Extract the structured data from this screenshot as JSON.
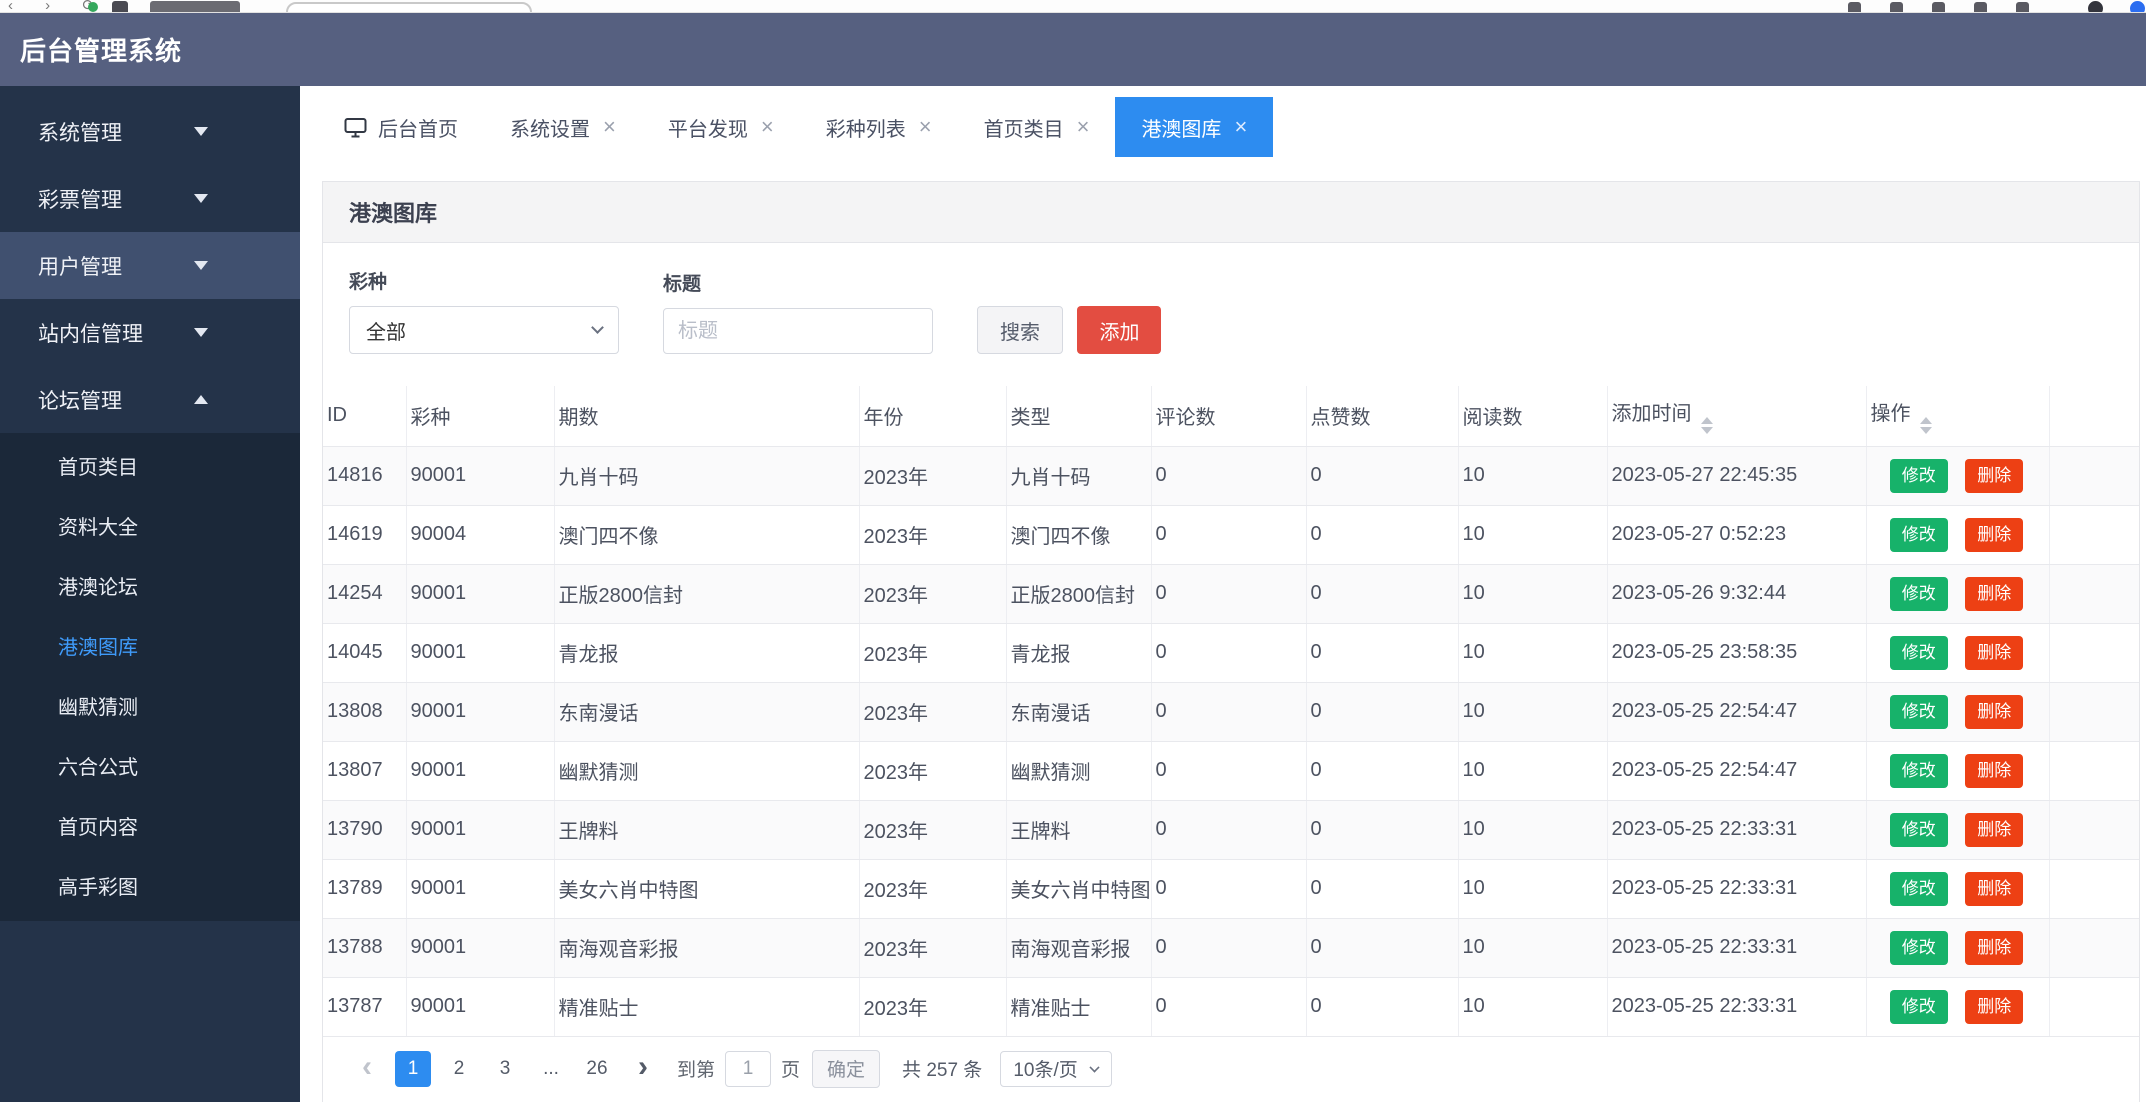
{
  "header": {
    "title": "后台管理系统"
  },
  "sidebar": {
    "items": [
      {
        "label": "系统管理",
        "active": false,
        "expanded": false
      },
      {
        "label": "彩票管理",
        "active": false,
        "expanded": false
      },
      {
        "label": "用户管理",
        "active": true,
        "expanded": false
      },
      {
        "label": "站内信管理",
        "active": false,
        "expanded": false
      },
      {
        "label": "论坛管理",
        "active": false,
        "expanded": true
      }
    ],
    "submenu": [
      {
        "label": "首页类目",
        "active": false
      },
      {
        "label": "资料大全",
        "active": false
      },
      {
        "label": "港澳论坛",
        "active": false
      },
      {
        "label": "港澳图库",
        "active": true
      },
      {
        "label": "幽默猜测",
        "active": false
      },
      {
        "label": "六合公式",
        "active": false
      },
      {
        "label": "首页内容",
        "active": false
      },
      {
        "label": "高手彩图",
        "active": false
      }
    ]
  },
  "tabs": [
    {
      "label": "后台首页",
      "icon": true,
      "closable": false,
      "active": false
    },
    {
      "label": "系统设置",
      "closable": true,
      "active": false
    },
    {
      "label": "平台发现",
      "closable": true,
      "active": false
    },
    {
      "label": "彩种列表",
      "closable": true,
      "active": false
    },
    {
      "label": "首页类目",
      "closable": true,
      "active": false
    },
    {
      "label": "港澳图库",
      "closable": true,
      "active": true
    }
  ],
  "icons": {
    "close": "×",
    "prev": "‹",
    "next": "›"
  },
  "panel": {
    "title": "港澳图库",
    "filters": {
      "lottery_label": "彩种",
      "lottery_value": "全部",
      "title_label": "标题",
      "title_placeholder": "标题",
      "search_label": "搜索",
      "add_label": "添加"
    }
  },
  "table": {
    "columns": [
      {
        "label": "ID"
      },
      {
        "label": "彩种"
      },
      {
        "label": "期数"
      },
      {
        "label": "年份"
      },
      {
        "label": "类型"
      },
      {
        "label": "评论数"
      },
      {
        "label": "点赞数"
      },
      {
        "label": "阅读数"
      },
      {
        "label": "添加时间",
        "sortable": true
      },
      {
        "label": "操作",
        "sortable": true
      }
    ],
    "edit_label": "修改",
    "delete_label": "删除",
    "rows": [
      {
        "id": "14816",
        "lottery": "90001",
        "issue": "九肖十码",
        "year": "2023年",
        "type": "九肖十码",
        "comments": "0",
        "likes": "0",
        "reads": "10",
        "time": "2023-05-27 22:45:35"
      },
      {
        "id": "14619",
        "lottery": "90004",
        "issue": "澳门四不像",
        "year": "2023年",
        "type": "澳门四不像",
        "comments": "0",
        "likes": "0",
        "reads": "10",
        "time": "2023-05-27 0:52:23"
      },
      {
        "id": "14254",
        "lottery": "90001",
        "issue": "正版2800信封",
        "year": "2023年",
        "type": "正版2800信封",
        "comments": "0",
        "likes": "0",
        "reads": "10",
        "time": "2023-05-26 9:32:44"
      },
      {
        "id": "14045",
        "lottery": "90001",
        "issue": "青龙报",
        "year": "2023年",
        "type": "青龙报",
        "comments": "0",
        "likes": "0",
        "reads": "10",
        "time": "2023-05-25 23:58:35"
      },
      {
        "id": "13808",
        "lottery": "90001",
        "issue": "东南漫话",
        "year": "2023年",
        "type": "东南漫话",
        "comments": "0",
        "likes": "0",
        "reads": "10",
        "time": "2023-05-25 22:54:47"
      },
      {
        "id": "13807",
        "lottery": "90001",
        "issue": "幽默猜测",
        "year": "2023年",
        "type": "幽默猜测",
        "comments": "0",
        "likes": "0",
        "reads": "10",
        "time": "2023-05-25 22:54:47"
      },
      {
        "id": "13790",
        "lottery": "90001",
        "issue": "王牌料",
        "year": "2023年",
        "type": "王牌料",
        "comments": "0",
        "likes": "0",
        "reads": "10",
        "time": "2023-05-25 22:33:31"
      },
      {
        "id": "13789",
        "lottery": "90001",
        "issue": "美女六肖中特图",
        "year": "2023年",
        "type": "美女六肖中特图",
        "comments": "0",
        "likes": "0",
        "reads": "10",
        "time": "2023-05-25 22:33:31"
      },
      {
        "id": "13788",
        "lottery": "90001",
        "issue": "南海观音彩报",
        "year": "2023年",
        "type": "南海观音彩报",
        "comments": "0",
        "likes": "0",
        "reads": "10",
        "time": "2023-05-25 22:33:31"
      },
      {
        "id": "13787",
        "lottery": "90001",
        "issue": "精准贴士",
        "year": "2023年",
        "type": "精准贴士",
        "comments": "0",
        "likes": "0",
        "reads": "10",
        "time": "2023-05-25 22:33:31"
      }
    ]
  },
  "pagination": {
    "pages": [
      {
        "label": "1",
        "active": true
      },
      {
        "label": "2",
        "active": false
      },
      {
        "label": "3",
        "active": false
      },
      {
        "label": "...",
        "active": false,
        "ellipsis": true
      },
      {
        "label": "26",
        "active": false
      }
    ],
    "goto_prefix": "到第",
    "goto_value": "1",
    "goto_suffix": "页",
    "confirm_label": "确定",
    "total_label": "共 257 条",
    "page_size": "10条/页"
  }
}
